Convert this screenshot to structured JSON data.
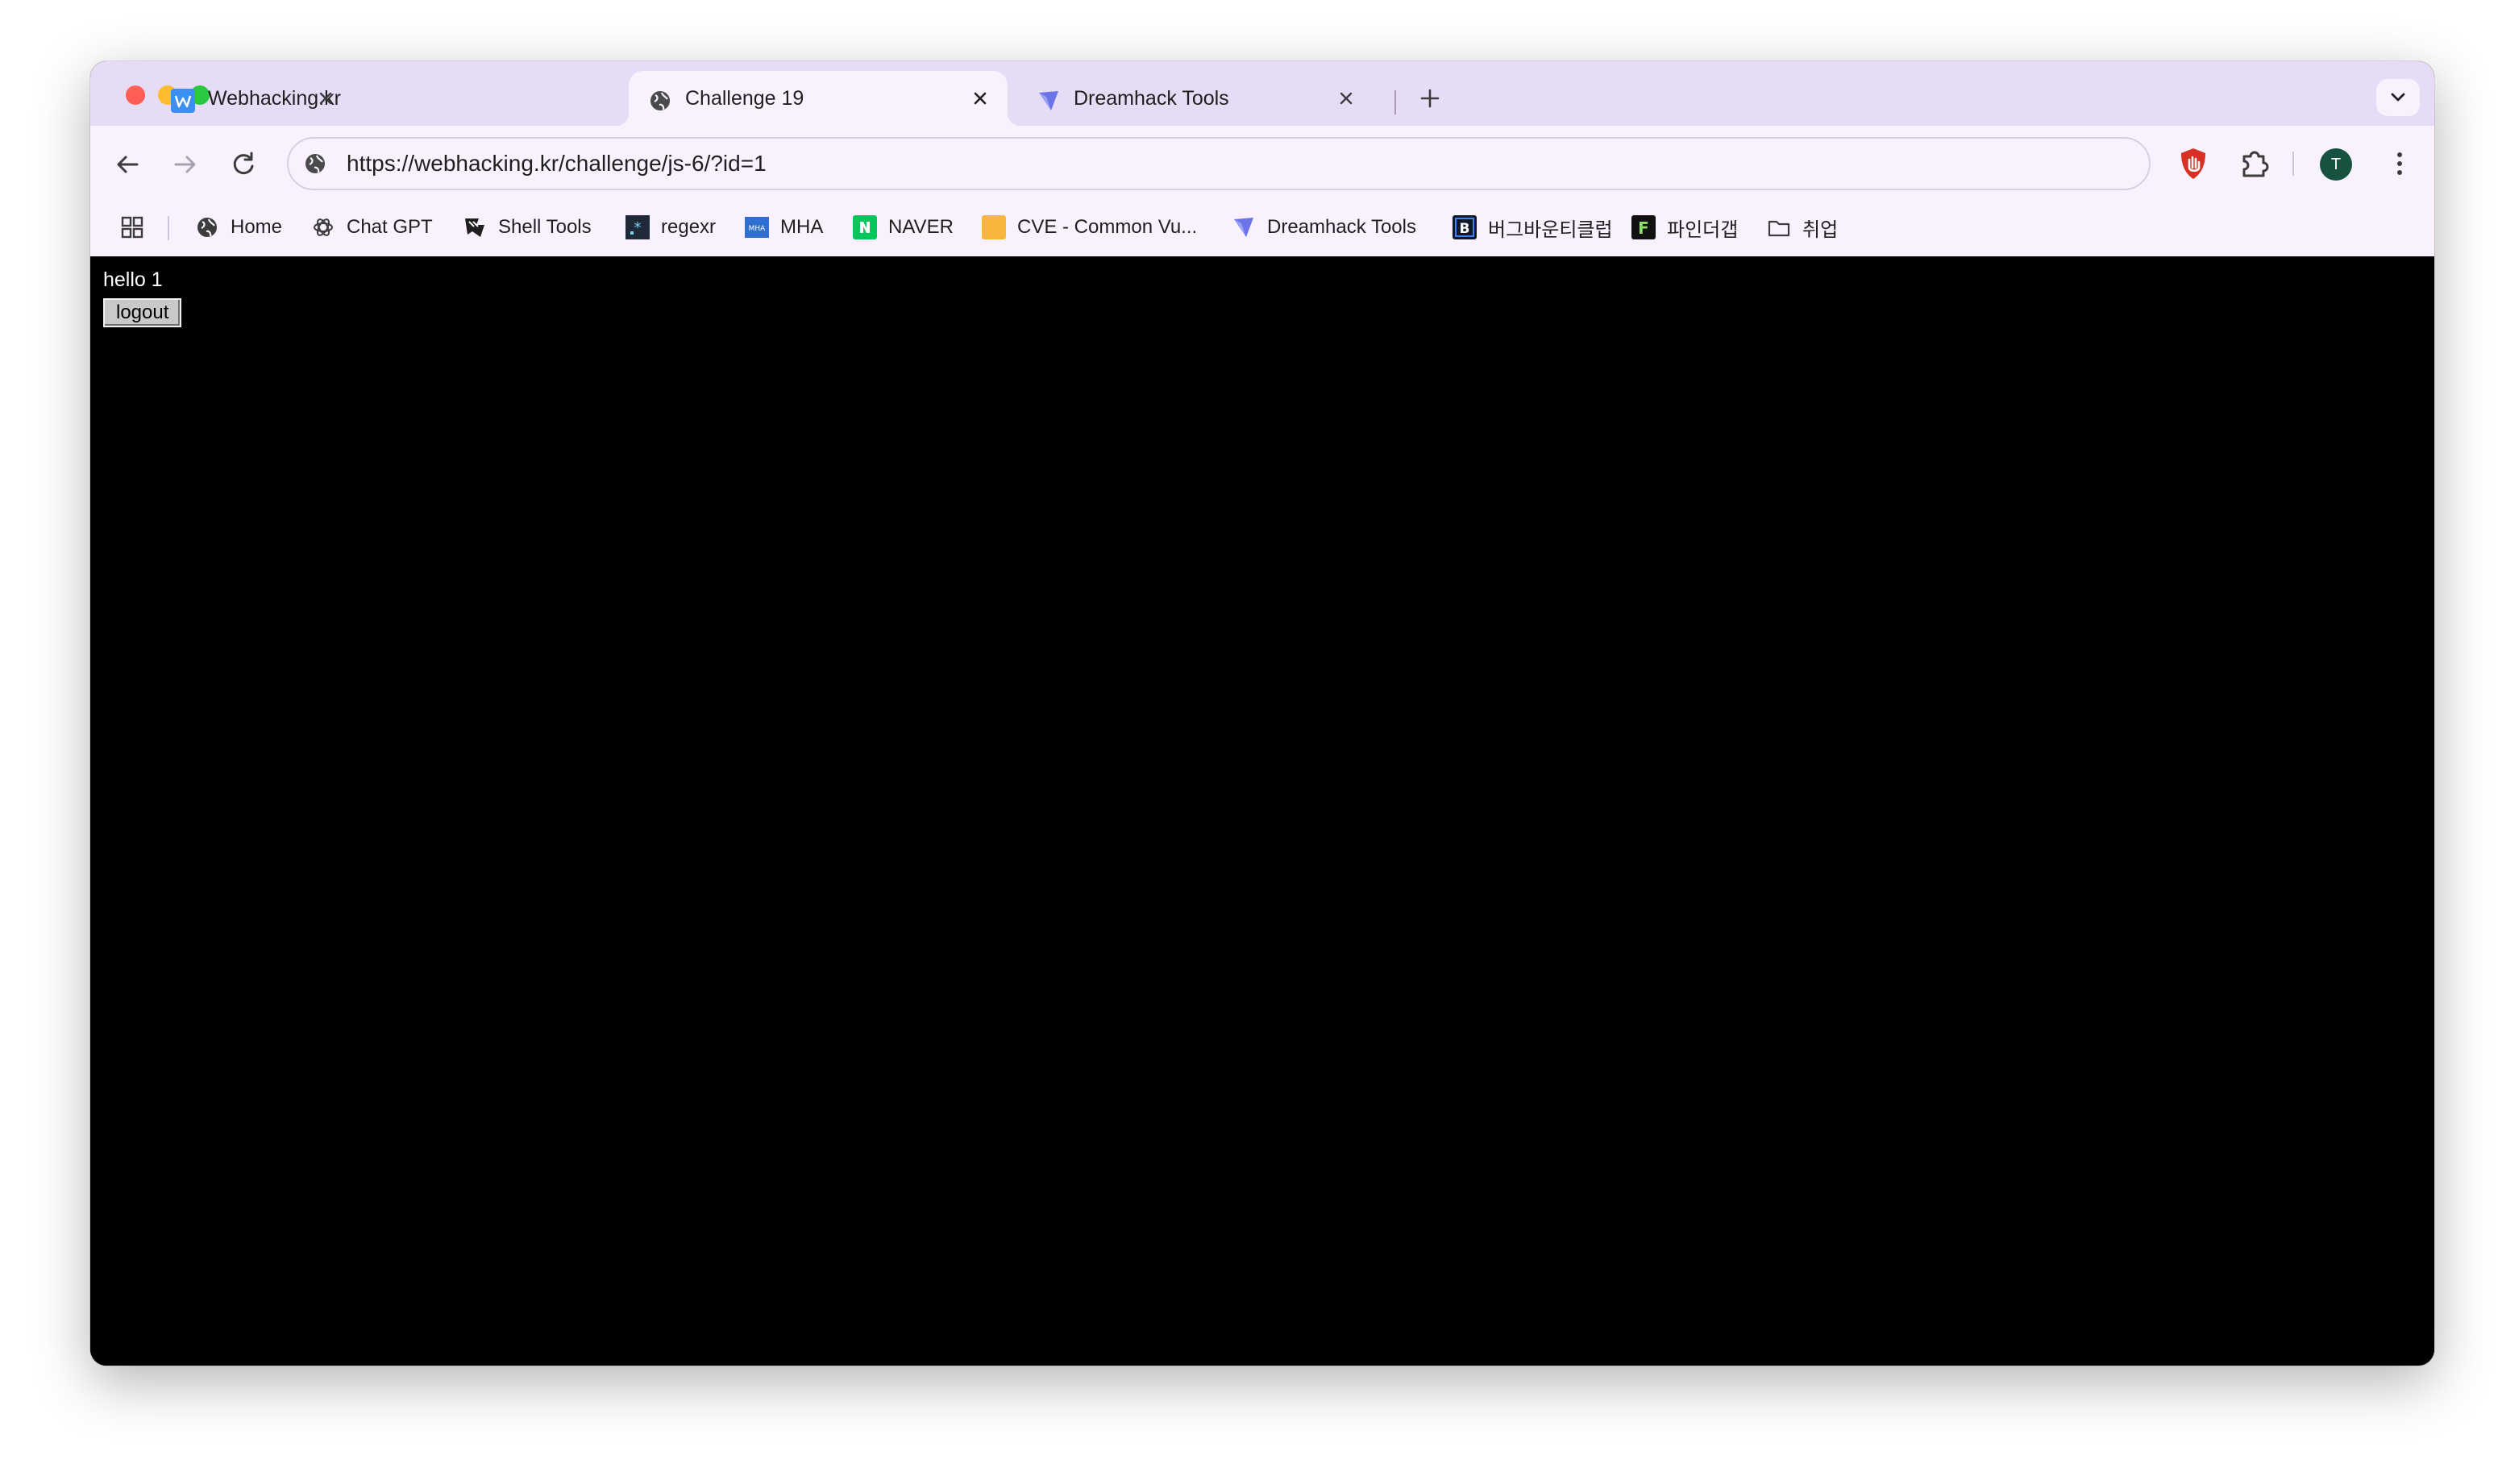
{
  "browser": {
    "tabs": [
      {
        "title": "Webhacking.kr",
        "icon": "w-icon",
        "active": false
      },
      {
        "title": "Challenge 19",
        "icon": "globe-icon",
        "active": true
      },
      {
        "title": "Dreamhack Tools",
        "icon": "dreamhack-icon",
        "active": false
      }
    ],
    "address_bar": {
      "url": "https://webhacking.kr/challenge/js-6/?id=1"
    },
    "profile_initial": "T",
    "bookmarks": [
      {
        "label": "Home",
        "icon": "globe-icon"
      },
      {
        "label": "Chat GPT",
        "icon": "openai-icon"
      },
      {
        "label": "Shell Tools",
        "icon": "shell-tools-icon"
      },
      {
        "label": "regexr",
        "icon": "regexr-icon"
      },
      {
        "label": "MHA",
        "icon": "mha-icon"
      },
      {
        "label": "NAVER",
        "icon": "naver-icon"
      },
      {
        "label": "CVE - Common Vu...",
        "icon": "cve-icon"
      },
      {
        "label": "Dreamhack Tools",
        "icon": "dreamhack-icon"
      },
      {
        "label": "버그바운티클럽",
        "icon": "b-icon"
      },
      {
        "label": "파인더갭",
        "icon": "f-icon"
      },
      {
        "label": "취업",
        "icon": "folder-icon"
      }
    ],
    "colors": {
      "tab_strip": "#e7dcf6",
      "toolbar": "#f9f2fe",
      "page_background": "#000000"
    }
  },
  "page": {
    "greeting": "hello 1",
    "logout_label": "logout"
  }
}
